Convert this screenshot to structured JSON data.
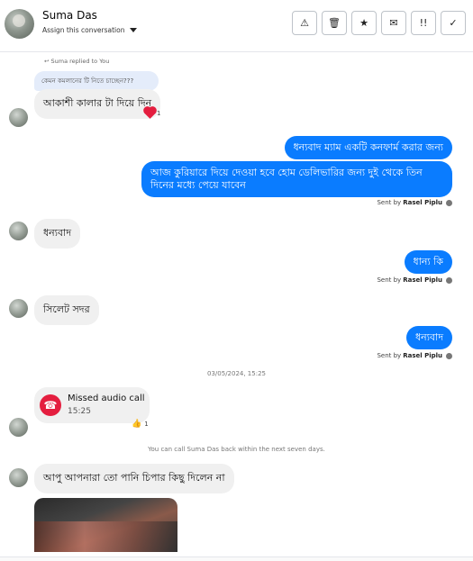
{
  "header": {
    "contact_name": "Suma Das",
    "assign_label": "Assign this conversation",
    "toolbar": [
      {
        "name": "report-button",
        "glyph": "⚠"
      },
      {
        "name": "delete-button",
        "glyph": "🗑"
      },
      {
        "name": "star-button",
        "glyph": "★"
      },
      {
        "name": "mark-unread-button",
        "glyph": "✉"
      },
      {
        "name": "follow-up-button",
        "glyph": "!!"
      },
      {
        "name": "done-button",
        "glyph": "✓"
      }
    ]
  },
  "messages": {
    "reply_note": "↩ Suma replied to You",
    "quoted_text": "কেমন কমলানের টি নিতে চাচ্ছেন???",
    "m1": "আকাশী কালার টা দিয়ে দিন",
    "m1_reaction_count": "1",
    "out1": "ধন্যবাদ ম্যাম একটি কনফার্ম করার জন্য",
    "out2": "আজ কুরিয়ারে দিয়ে দেওয়া হবে হোম ডেলিভারির জন্য দুই থেকে তিন দিনের মধ্যে পেয়ে যাবেন",
    "sent_by_prefix": "Sent by",
    "sent_by_name": "Rasel Piplu",
    "m2": "ধন্যবাদ",
    "out3": "ধান্য কি",
    "m3": "সিলেট সদর",
    "out4": "ধন্যবাদ",
    "timestamp": "03/05/2024, 15:25",
    "call_title": "Missed audio call",
    "call_duration": "15:25",
    "call_reaction_count": "1",
    "call_note": "You can call Suma Das back within the next seven days.",
    "m4": "আপু আপনারা তো পানি চিপার কিছু দিলেন না"
  },
  "colors": {
    "outgoing_bubble": "#0a7cff",
    "incoming_bubble": "#f0f0f0",
    "missed_call": "#e41e3f"
  }
}
